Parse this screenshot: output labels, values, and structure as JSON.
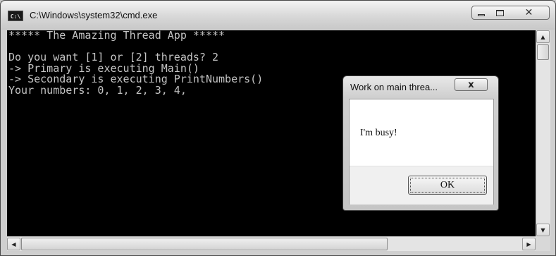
{
  "window": {
    "title": "C:\\Windows\\system32\\cmd.exe",
    "icon_label": "C:\\",
    "minimize_icon": "minimize-icon",
    "maximize_icon": "maximize-icon",
    "close_icon": "close-icon"
  },
  "console": {
    "lines": [
      "***** The Amazing Thread App *****",
      "",
      "Do you want [1] or [2] threads? 2",
      "-> Primary is executing Main()",
      "-> Secondary is executing PrintNumbers()",
      "Your numbers: 0, 1, 2, 3, 4,"
    ]
  },
  "dialog": {
    "title": "Work on main threa...",
    "close_glyph": "x",
    "message": "I'm busy!",
    "ok_label": "OK"
  },
  "scrollbars": {
    "up_glyph": "▲",
    "down_glyph": "▼",
    "left_glyph": "◀",
    "right_glyph": "▶"
  },
  "colors": {
    "console_bg": "#000000",
    "console_text": "#c4c4c4"
  }
}
